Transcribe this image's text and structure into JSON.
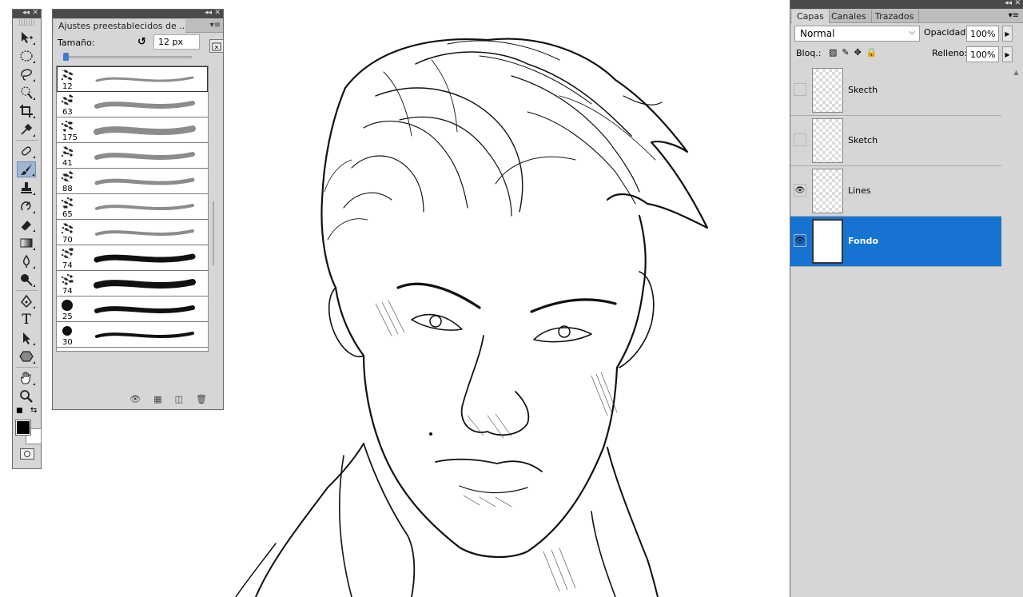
{
  "tools": {
    "items": [
      {
        "name": "move-tool-icon"
      },
      {
        "name": "marquee-tool-icon"
      },
      {
        "name": "lasso-tool-icon"
      },
      {
        "name": "quick-selection-tool-icon"
      },
      {
        "name": "crop-tool-icon"
      },
      {
        "name": "eyedropper-tool-icon"
      },
      {
        "name": "healing-brush-tool-icon"
      },
      {
        "name": "brush-tool-icon"
      },
      {
        "name": "clone-stamp-tool-icon"
      },
      {
        "name": "history-brush-tool-icon"
      },
      {
        "name": "eraser-tool-icon"
      },
      {
        "name": "gradient-tool-icon"
      },
      {
        "name": "blur-tool-icon"
      },
      {
        "name": "dodge-tool-icon"
      },
      {
        "name": "pen-tool-icon"
      },
      {
        "name": "type-tool-icon"
      },
      {
        "name": "path-selection-tool-icon"
      },
      {
        "name": "shape-tool-icon"
      },
      {
        "name": "hand-tool-icon"
      },
      {
        "name": "zoom-tool-icon"
      }
    ],
    "type_glyph": "T",
    "active": "brush-tool-icon"
  },
  "brush_panel": {
    "tab_label": "Ajustes preestablecidos de ...",
    "size_label": "Tamaño:",
    "size_value": "12 px",
    "size_fraction": 0.0,
    "presets": [
      {
        "size": "12",
        "selected": true
      },
      {
        "size": "63"
      },
      {
        "size": "175"
      },
      {
        "size": "41"
      },
      {
        "size": "88"
      },
      {
        "size": "65"
      },
      {
        "size": "70"
      },
      {
        "size": "74"
      },
      {
        "size": "74"
      },
      {
        "size": "25"
      },
      {
        "size": "30"
      },
      {
        "size": ""
      }
    ]
  },
  "layers_panel": {
    "tabs": [
      "Capas",
      "Canales",
      "Trazados"
    ],
    "active_tab": "Capas",
    "blend_mode": "Normal",
    "opacity_label": "Opacidad:",
    "opacity_value": "100%",
    "lock_label": "Bloq.:",
    "fill_label": "Relleno:",
    "fill_value": "100%",
    "layers": [
      {
        "name": "Skecth",
        "visible": false,
        "selected": false,
        "thumb": "transparent"
      },
      {
        "name": "Sketch",
        "visible": false,
        "selected": false,
        "thumb": "transparent"
      },
      {
        "name": "Lines",
        "visible": true,
        "selected": false,
        "thumb": "transparent"
      },
      {
        "name": "Fondo",
        "visible": true,
        "selected": true,
        "thumb": "white"
      }
    ]
  },
  "colors": {
    "selection_blue": "#1773d2",
    "panel_gray": "#d6d6d6",
    "foreground": "#000000",
    "background": "#ffffff"
  }
}
